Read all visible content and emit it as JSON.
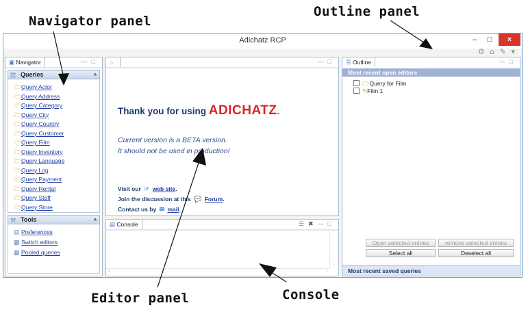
{
  "annotations": {
    "navigator_panel": "Navigator panel",
    "outline_panel": "Outline panel",
    "editor_panel": "Editor panel",
    "console": "Console"
  },
  "window": {
    "title": "Adichatz RCP",
    "minimize": "–",
    "maximize": "□",
    "close": "×",
    "toolbar_icons": "⚙ ⌂ ✎ ▾"
  },
  "navigator": {
    "tab_label": "Navigator",
    "queries_title": "Queries",
    "queries_collapse": "»",
    "queries": [
      "Query Actor",
      "Query Address",
      "Query Category",
      "Query City",
      "Query Country",
      "Query Customer",
      "Query Film",
      "Query Inventory",
      "Query Language",
      "Query Log",
      "Query Payment",
      "Query Rental",
      "Query Staff",
      "Query Store"
    ],
    "tools_title": "Tools",
    "tools_collapse": "»",
    "tools": [
      "Preferences",
      "Switch editors",
      "Pooled queries"
    ]
  },
  "editor": {
    "tab_icon": "home-icon",
    "thanks_text": "Thank you for using",
    "brand": "ADICHATZ",
    "brand_suffix": ".",
    "beta_line1": "Current version is a BETA version.",
    "beta_line2": "It should not be used in production!",
    "visit_prefix": "Visit our",
    "visit_link": "web site",
    "visit_suffix": ".",
    "join_prefix": "Join the discussion at this",
    "join_link": "Forum",
    "join_suffix": ".",
    "contact_prefix": "Contact us by",
    "contact_link": "mail",
    "contact_suffix": "."
  },
  "console": {
    "tab_label": "Console"
  },
  "outline": {
    "tab_label": "Outline",
    "recent_open_header": "Most recent open editors",
    "items": [
      "Query for Film",
      "Film 1"
    ],
    "buttons": {
      "open_selected": "Open selected entries",
      "remove_selected": "remove selected entries",
      "select_all": "Select all",
      "deselect_all": "Deselect all"
    },
    "recent_saved_header": "Most recent saved queries"
  },
  "colors": {
    "brand": "#d9252a",
    "link": "#1f3ea4",
    "close_button": "#d7352a",
    "section_header": "#9fb2d2"
  }
}
